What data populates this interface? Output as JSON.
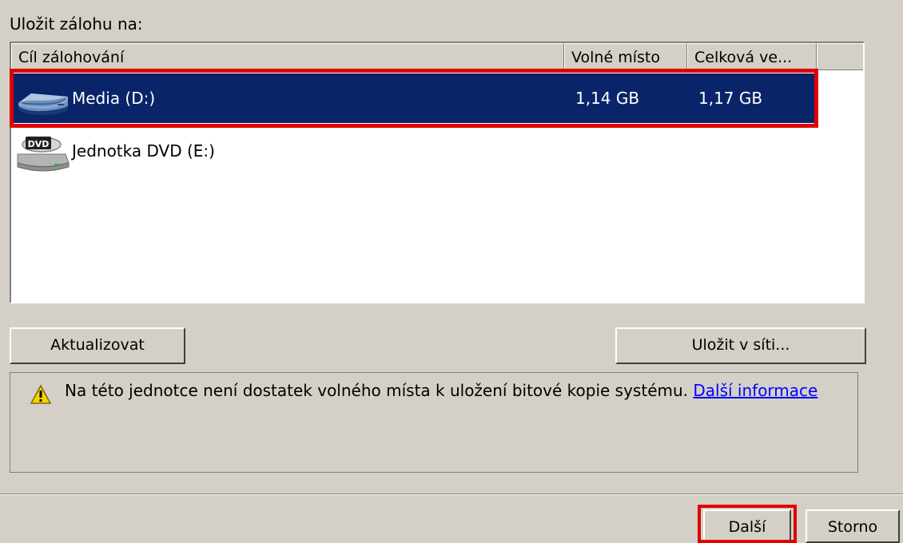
{
  "save_to_label": "Uložit zálohu na:",
  "columns": [
    "Cíl zálohování",
    "Volné místo",
    "Celková ve..."
  ],
  "drives": [
    {
      "icon": "hard-drive-icon",
      "name": "Media (D:)",
      "free": "1,14 GB",
      "total": "1,17 GB",
      "selected": true
    },
    {
      "icon": "dvd-drive-icon",
      "icon_text": "DVD",
      "name": "Jednotka DVD (E:)",
      "free": "",
      "total": "",
      "selected": false
    }
  ],
  "buttons": {
    "refresh": "Aktualizovat",
    "save_network": "Uložit v síti...",
    "next": "Další",
    "cancel": "Storno"
  },
  "warning": {
    "icon": "warning-icon",
    "text": "Na této jednotce není dostatek volného místa k uložení bitové kopie systému.",
    "link_text": "Další informace"
  },
  "colors": {
    "selection_background": "#0a246a",
    "highlight_outline": "#e00000",
    "dialog_background": "#d4d0c8",
    "link": "#0000ff"
  }
}
